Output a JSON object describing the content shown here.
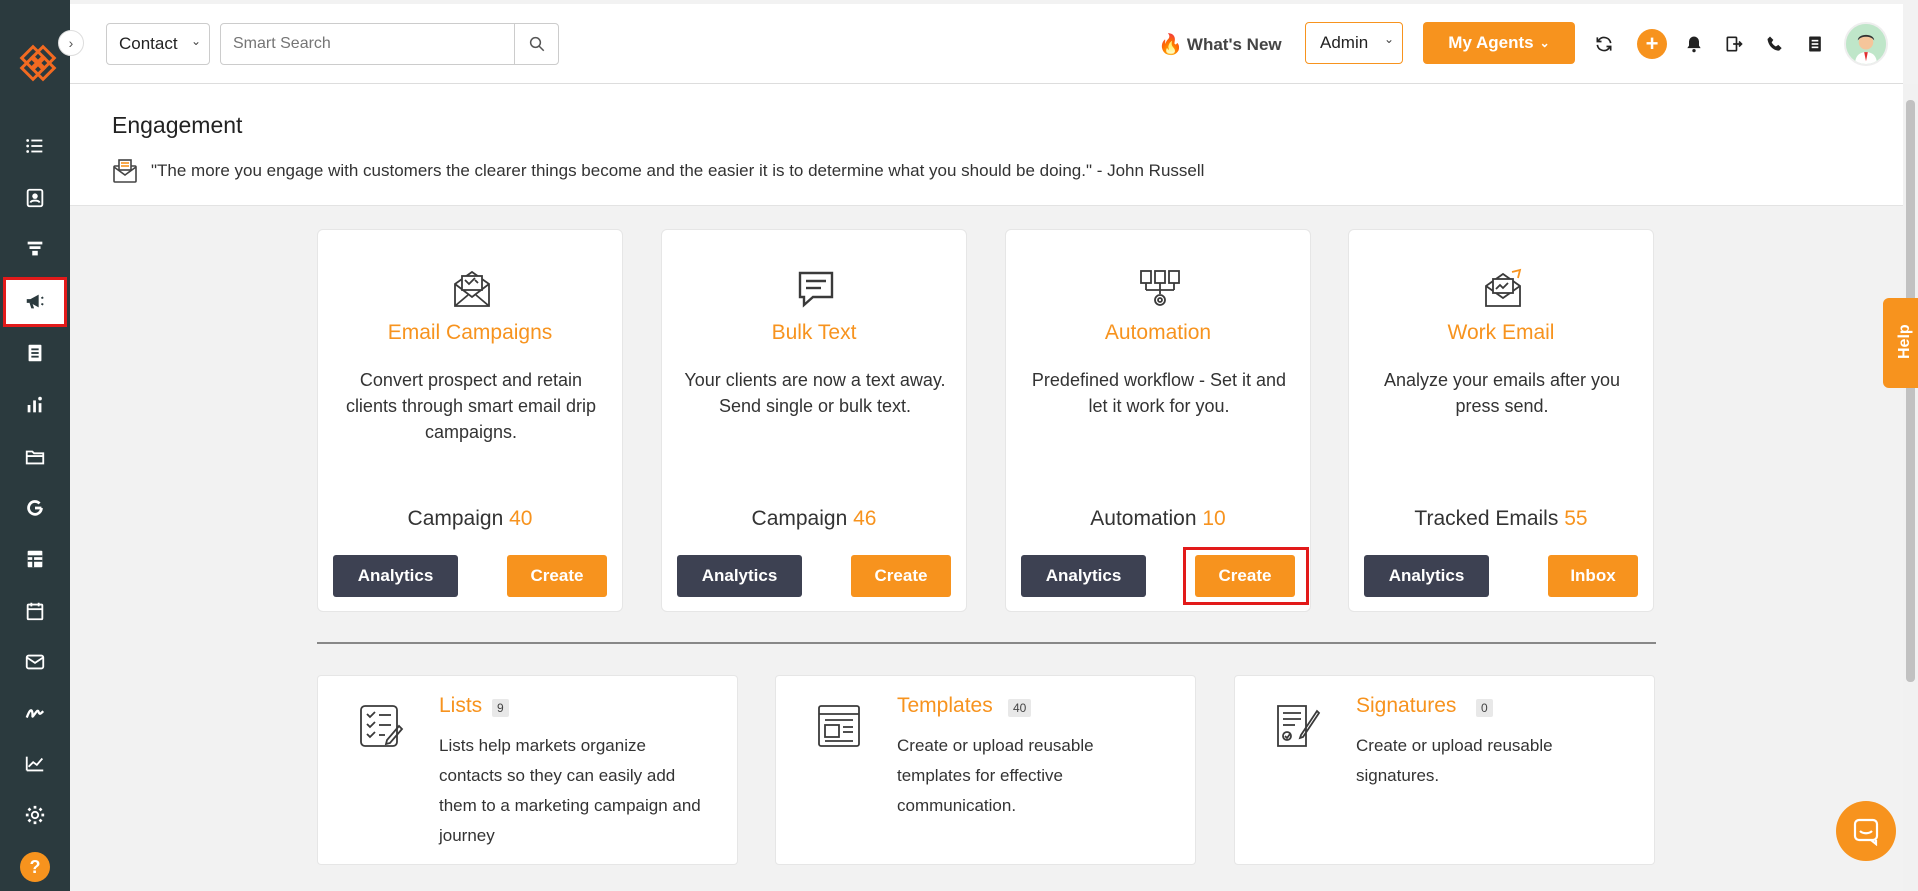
{
  "topbar": {
    "contact_select": "Contact",
    "search_placeholder": "Smart Search",
    "whats_new": "What's New",
    "admin_select": "Admin",
    "my_agents": "My Agents",
    "plus": "+"
  },
  "page": {
    "title": "Engagement",
    "quote": "\"The more you engage with customers the clearer things become and the easier it is to determine what you should be doing.\" - John Russell"
  },
  "help_tab": "Help",
  "cards": [
    {
      "title": "Email Campaigns",
      "desc": "Convert prospect and retain clients through smart email drip campaigns.",
      "count_label": "Campaign",
      "count": "40",
      "left_btn": "Analytics",
      "right_btn": "Create"
    },
    {
      "title": "Bulk Text",
      "desc": "Your clients are now a text away. Send single or bulk text.",
      "count_label": "Campaign",
      "count": "46",
      "left_btn": "Analytics",
      "right_btn": "Create"
    },
    {
      "title": "Automation",
      "desc": "Predefined workflow - Set it and let it work for you.",
      "count_label": "Automation",
      "count": "10",
      "left_btn": "Analytics",
      "right_btn": "Create"
    },
    {
      "title": "Work Email",
      "desc": "Analyze your emails after you press send.",
      "count_label": "Tracked Emails",
      "count": "55",
      "left_btn": "Analytics",
      "right_btn": "Inbox"
    }
  ],
  "lower_cards": [
    {
      "title": "Lists",
      "badge": "9",
      "desc": "Lists help markets organize contacts so they can easily add them to a marketing campaign and journey"
    },
    {
      "title": "Templates",
      "badge": "40",
      "desc": "Create or upload reusable templates for effective communication."
    },
    {
      "title": "Signatures",
      "badge": "0",
      "desc": "Create or upload reusable signatures."
    }
  ],
  "sidebar": {
    "items": [
      "list-icon",
      "contacts-icon",
      "funnel-icon",
      "megaphone-icon",
      "document-icon",
      "chart-bar-icon",
      "folder-icon",
      "google-icon",
      "table-icon",
      "calendar-icon",
      "mail-icon",
      "signature-icon",
      "trend-icon",
      "gear-icon"
    ],
    "active": "megaphone-icon",
    "help": "?"
  },
  "colors": {
    "accent": "#f7931e",
    "sidebar": "#2b3a3e",
    "dark_button": "#3d4152",
    "highlight": "#e21a1a"
  }
}
